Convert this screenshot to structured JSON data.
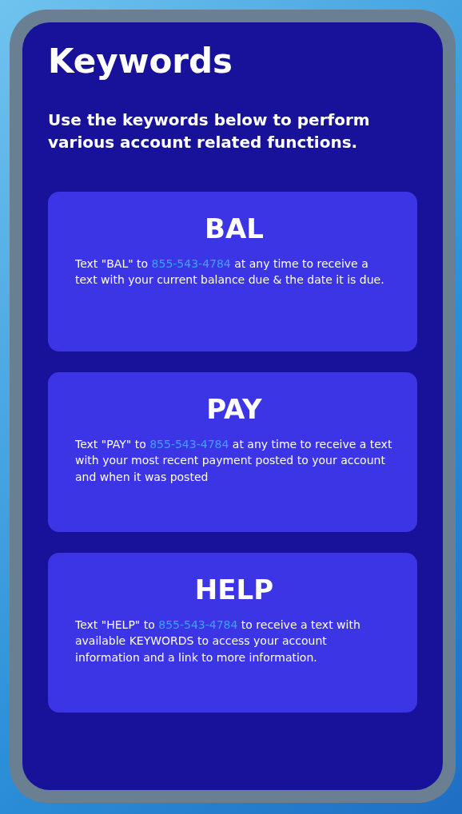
{
  "heading": "Keywords",
  "intro": "Use the keywords below to perform various account related functions.",
  "cards": [
    {
      "title": "BAL",
      "text_before": "Text \"BAL\" to ",
      "link": "855-543-4784",
      "text_after": " at any time to receive a text with your current balance due & the date it is due."
    },
    {
      "title": "PAY",
      "text_before": "Text \"PAY\" to ",
      "link": "855-543-4784",
      "text_after": " at any time to receive a text with your most recent payment posted to your account and when it was posted"
    },
    {
      "title": "HELP",
      "text_before": "Text \"HELP\" to ",
      "link": "855-543-4784",
      "text_after": " to receive a text with available KEYWORDS to access your account information and a link to more information."
    }
  ]
}
